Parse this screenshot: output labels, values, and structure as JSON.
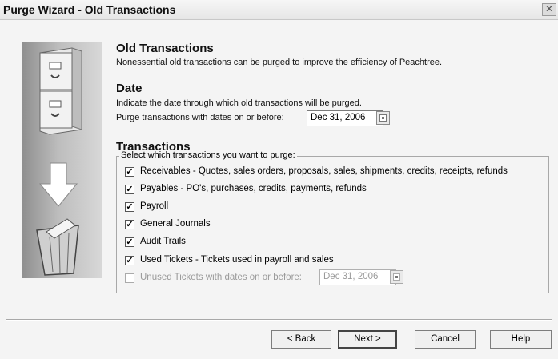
{
  "window": {
    "title": "Purge Wizard - Old Transactions",
    "close_glyph": "✕"
  },
  "header": {
    "title": "Old Transactions",
    "description": "Nonessential old transactions can be purged to improve the efficiency of Peachtree."
  },
  "date_section": {
    "title": "Date",
    "description": "Indicate the date through which old transactions will be purged.",
    "field_label": "Purge transactions with dates on or before:",
    "field_value": "Dec 31, 2006"
  },
  "transactions_section": {
    "title": "Transactions",
    "group_label": "Select which transactions you want to purge:",
    "items": [
      {
        "label": "Receivables - Quotes, sales orders, proposals, sales, shipments, credits, receipts, refunds",
        "checked": true
      },
      {
        "label": "Payables - PO's, purchases, credits, payments, refunds",
        "checked": true
      },
      {
        "label": "Payroll",
        "checked": true
      },
      {
        "label": "General Journals",
        "checked": true
      },
      {
        "label": "Audit Trails",
        "checked": true
      },
      {
        "label": "Used Tickets - Tickets used in payroll and sales",
        "checked": true
      },
      {
        "label": "Unused Tickets with dates on or before:",
        "checked": false,
        "disabled": true
      }
    ],
    "unused_date_value": "Dec 31, 2006"
  },
  "buttons": {
    "back": "< Back",
    "next": "Next >",
    "cancel": "Cancel",
    "help": "Help"
  },
  "icons": {
    "cabinet": "file-cabinet-icon",
    "arrow": "arrow-down-icon",
    "trash": "wastebasket-icon",
    "calendar": "calendar-icon",
    "check": "✓"
  },
  "colors": {
    "window_bg": "#f4f4f4",
    "disabled_text": "#9a9a9a"
  }
}
